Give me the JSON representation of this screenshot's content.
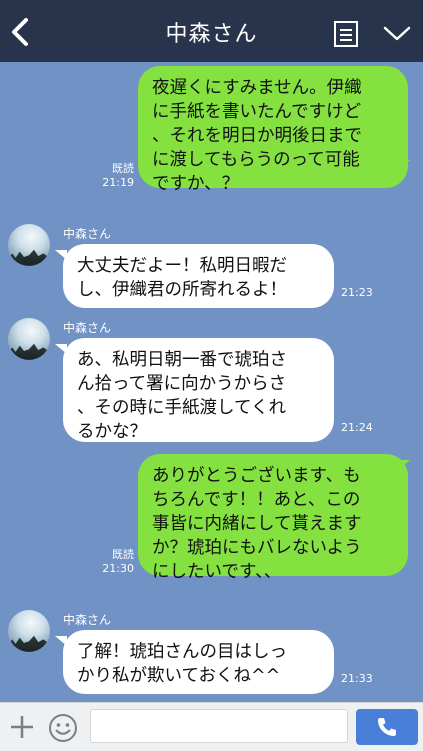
{
  "header": {
    "title": "中森さん",
    "back_icon": "chevron-left-icon",
    "memo_icon": "memo-icon",
    "menu_icon": "chevron-down-icon"
  },
  "colors": {
    "header_bg": "#27344b",
    "chat_bg": "#7192c4",
    "outgoing_bubble": "#84e140",
    "incoming_bubble": "#ffffff",
    "call_button": "#4a7fd9"
  },
  "messages": [
    {
      "direction": "out",
      "text": "夜遅くにすみません。伊織\nに手紙を書いたんですけど\n、それを明日か明後日まで\nに渡してもらうのって可能\nですか、？",
      "read": "既読",
      "time": "21:19"
    },
    {
      "direction": "in",
      "sender": "中森さん",
      "text": "大丈夫だよー！私明日暇だ\nし、伊織君の所寄れるよ！",
      "time": "21:23"
    },
    {
      "direction": "in",
      "sender": "中森さん",
      "text": "あ、私明日朝一番で琥珀さ\nん拾って署に向かうからさ\n、その時に手紙渡してくれ\nるかな？",
      "time": "21:24"
    },
    {
      "direction": "out",
      "text": "ありがとうございます、も\nちろんです！！あと、この\n事皆に内緒にして貰えます\nか？琥珀にもバレないよう\nにしたいです、、",
      "read": "既読",
      "time": "21:30"
    },
    {
      "direction": "in",
      "sender": "中森さん",
      "text": "了解！琥珀さんの目はしっ\nかり私が欺いておくね^^",
      "time": "21:33"
    }
  ],
  "input_bar": {
    "plus_icon": "plus-icon",
    "emoji_icon": "smiley-icon",
    "message_value": "",
    "call_icon": "phone-icon"
  }
}
